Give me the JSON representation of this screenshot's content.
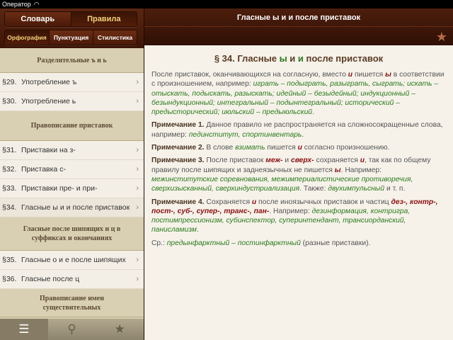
{
  "status": {
    "carrier": "Оператор"
  },
  "header": {
    "tabs": [
      "Словарь",
      "Правила"
    ],
    "selected_tab": 1,
    "subtabs": [
      "Орфография",
      "Пунктуация",
      "Стилистика"
    ],
    "selected_subtab": 0,
    "title": "Гласные ы и и после приставок"
  },
  "sidebar": {
    "items": [
      {
        "type": "section",
        "label": "Разделительные ъ и ь"
      },
      {
        "type": "row",
        "num": "§29.",
        "label": "Употребление ъ"
      },
      {
        "type": "row",
        "num": "§30.",
        "label": "Употребление ь"
      },
      {
        "type": "section",
        "label": "Правописание приставок"
      },
      {
        "type": "row",
        "num": "§31.",
        "label": "Приставки на з-"
      },
      {
        "type": "row",
        "num": "§32.",
        "label": "Приставка с-"
      },
      {
        "type": "row",
        "num": "§33.",
        "label": "Приставки пре- и при-"
      },
      {
        "type": "row",
        "num": "§34.",
        "label": "Гласные ы и и после приставок",
        "selected": true
      },
      {
        "type": "section",
        "label": "Гласные после шипящих и ц в суффиксах и окончаниях"
      },
      {
        "type": "row",
        "num": "§35.",
        "label": "Гласные о и е после шипящих"
      },
      {
        "type": "row",
        "num": "§36.",
        "label": "Гласные после ц"
      },
      {
        "type": "section",
        "label": "Правописание имен существительных"
      }
    ]
  },
  "tabbar": {
    "items": [
      {
        "icon": "list-icon"
      },
      {
        "icon": "search-icon"
      },
      {
        "icon": "star-icon"
      }
    ]
  },
  "main": {
    "title": [
      {
        "t": "§ 34. Гласные ",
        "s": ""
      },
      {
        "t": "ы",
        "s": "g"
      },
      {
        "t": " и ",
        "s": ""
      },
      {
        "t": "и",
        "s": "g"
      },
      {
        "t": " после приставок",
        "s": ""
      }
    ],
    "paragraphs": [
      [
        {
          "t": "После приставок, оканчивающихся на согласную, вместо ",
          "s": ""
        },
        {
          "t": "и",
          "s": "r"
        },
        {
          "t": " пишется ",
          "s": ""
        },
        {
          "t": "ы",
          "s": "r"
        },
        {
          "t": " в соответствии с произношением, например: ",
          "s": ""
        },
        {
          "t": "играть – подыграть, разыграть, сыграть; искать – отыскать, подыскать, разыскать; идейный – безыдейный; индукционный – безындукционный; интегральный – подынтегральный; исторический – предысторический; июльский – предыюльский",
          "s": "g"
        },
        {
          "t": ".",
          "s": ""
        }
      ],
      [
        {
          "t": "Примечание 1.",
          "s": "b"
        },
        {
          "t": " Данное правило не распространяется на сложносокращенные слова, например: ",
          "s": ""
        },
        {
          "t": "пединститут, спортинвентарь",
          "s": "g"
        },
        {
          "t": ".",
          "s": ""
        }
      ],
      [
        {
          "t": "Примечание 2.",
          "s": "b"
        },
        {
          "t": " В слове ",
          "s": ""
        },
        {
          "t": "взимать",
          "s": "g"
        },
        {
          "t": " пишется ",
          "s": ""
        },
        {
          "t": "и",
          "s": "r"
        },
        {
          "t": " согласно произношению.",
          "s": ""
        }
      ],
      [
        {
          "t": "Примечание 3.",
          "s": "b"
        },
        {
          "t": " После приставок ",
          "s": ""
        },
        {
          "t": "меж-",
          "s": "r"
        },
        {
          "t": " и ",
          "s": ""
        },
        {
          "t": "сверх-",
          "s": "r"
        },
        {
          "t": " сохраняется ",
          "s": ""
        },
        {
          "t": "и",
          "s": "r"
        },
        {
          "t": ", так как по общему правилу после шипящих и заднеязычных не пишется ",
          "s": ""
        },
        {
          "t": "ы",
          "s": "r"
        },
        {
          "t": ". Например: ",
          "s": ""
        },
        {
          "t": "межинститутские соревнования, межимпериалистические противоречия, сверхизысканный, сверхиндустриализация",
          "s": "g"
        },
        {
          "t": ". Также: ",
          "s": ""
        },
        {
          "t": "двухимпульсный",
          "s": "g"
        },
        {
          "t": " и т. п.",
          "s": ""
        }
      ],
      [
        {
          "t": "Примечание 4.",
          "s": "b"
        },
        {
          "t": " Сохраняется ",
          "s": ""
        },
        {
          "t": "и",
          "s": "r"
        },
        {
          "t": " после иноязычных приставок и частиц ",
          "s": ""
        },
        {
          "t": "дез-, контр-, пост-, суб-, супер-, транс-, пан-",
          "s": "r"
        },
        {
          "t": ". Например: ",
          "s": ""
        },
        {
          "t": "дезинформация, контригра, постимпрессионизм, субинспектор, суперинтендант, трансиорданский, панисламизм",
          "s": "g"
        },
        {
          "t": ".",
          "s": ""
        }
      ],
      [
        {
          "t": "Ср.: ",
          "s": ""
        },
        {
          "t": "предынфарктный – постинфарктный",
          "s": "g"
        },
        {
          "t": " (разные приставки).",
          "s": ""
        }
      ]
    ]
  },
  "colors": {
    "green": "#2a7a1a",
    "red": "#8b0f0f",
    "header": "#4d1e0c"
  }
}
